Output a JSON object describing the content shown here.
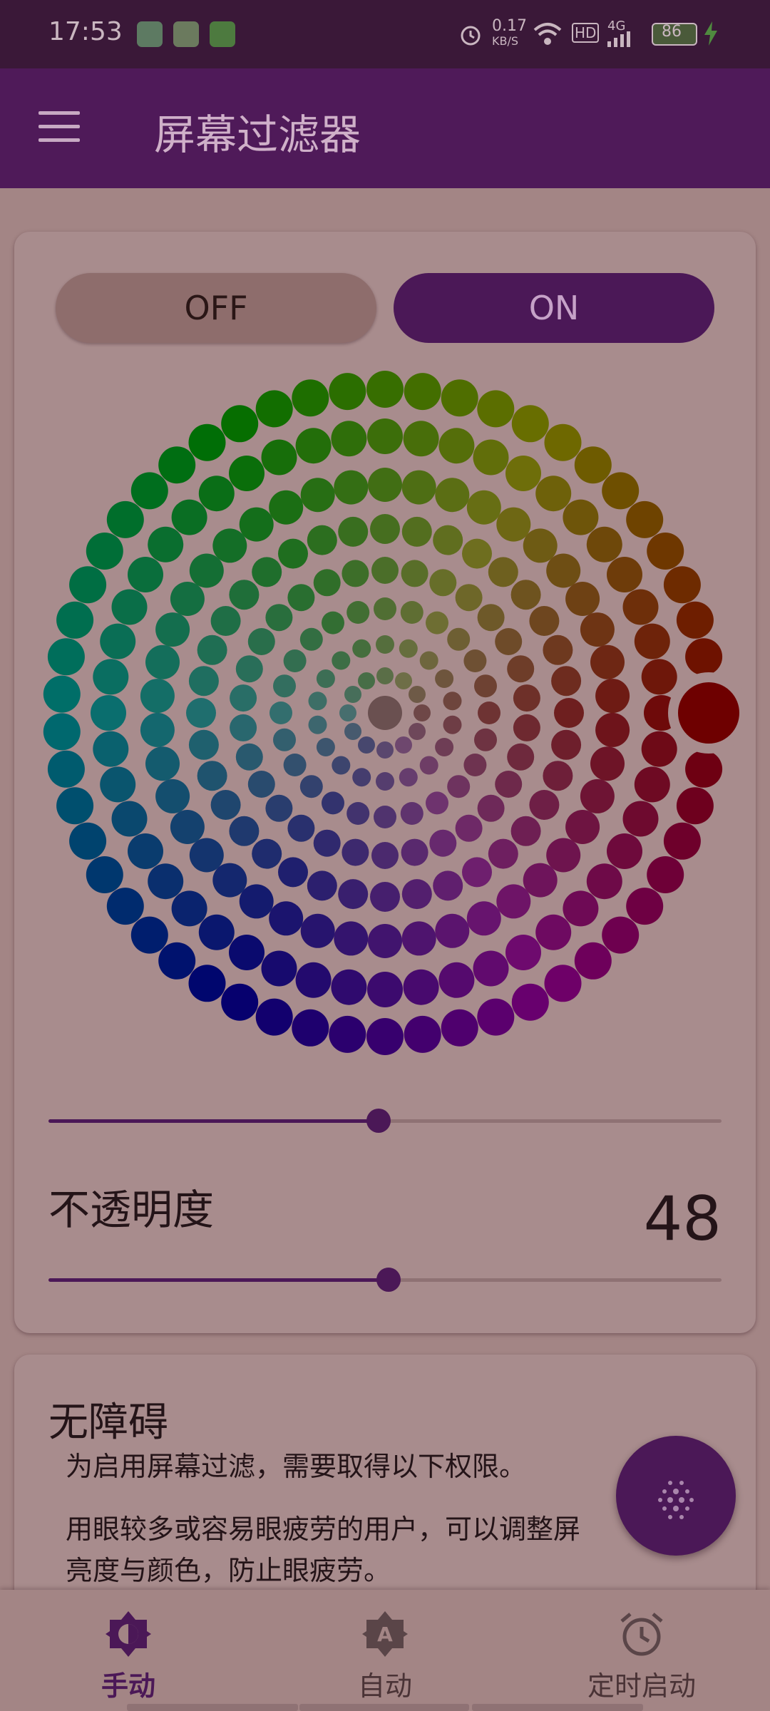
{
  "status_bar": {
    "time": "17:53",
    "network_speed": "0.17",
    "network_unit": "KB/S",
    "hd": "HD",
    "signal": "4G",
    "battery": "86",
    "notification_icons": [
      "download-icon",
      "shield-app-icon",
      "message-app-icon"
    ],
    "right_icons": [
      "alarm-icon",
      "wifi-icon",
      "signal-icon",
      "battery-icon",
      "charging-icon"
    ]
  },
  "app_bar": {
    "title": "屏幕过滤器",
    "menu_icon": "menu-icon"
  },
  "filter": {
    "off_label": "OFF",
    "on_label": "ON",
    "selected": "ON",
    "color_slider_value": 0.49,
    "opacity_label": "不透明度",
    "opacity_value": "48",
    "opacity_slider_value": 0.505
  },
  "accessibility": {
    "title": "无障碍",
    "paragraph1": "为启用屏幕过滤，需要取得以下权限。",
    "paragraph2_line1": "用眼较多或容易眼疲劳的用户，可以调整屏",
    "paragraph2_line2": "亮度与颜色，防止眼疲劳。"
  },
  "fab": {
    "icon": "dot-grid-icon"
  },
  "bottom_nav": {
    "items": [
      {
        "label": "手动",
        "icon": "brightness-icon",
        "active": true
      },
      {
        "label": "自动",
        "icon": "auto-brightness-icon",
        "active": false
      },
      {
        "label": "定时启动",
        "icon": "alarm-clock-icon",
        "active": false
      }
    ]
  },
  "colors": {
    "accent": "#4b1857",
    "app_bar": "#4f1a59",
    "status_bar": "#3a1838",
    "background": "#a38585",
    "card": "#a88c8d",
    "selected_color": "#6e0000"
  }
}
